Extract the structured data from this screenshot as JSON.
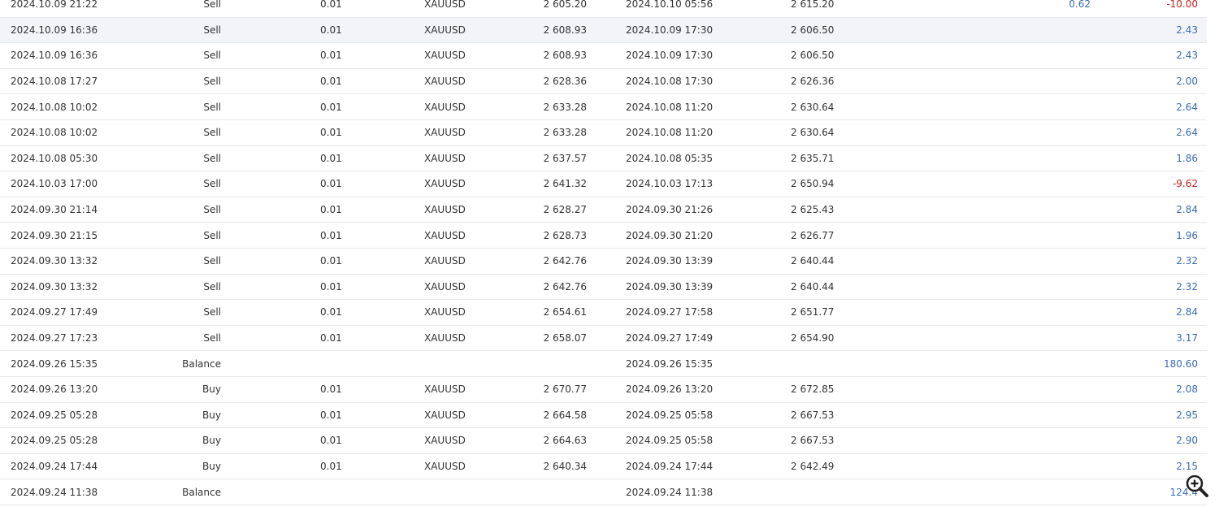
{
  "colors": {
    "positive": "#3b6cb4",
    "negative": "#cc1f1f",
    "row_highlight": "#f3f4f7",
    "row_border": "#e4e7ec"
  },
  "zoom_button": {
    "icon": "zoom-in-icon"
  },
  "rows": [
    {
      "open_time": "2024.10.09 21:22",
      "type": "Sell",
      "volume": "0.01",
      "symbol": "XAUUSD",
      "open_price": "2 605.20",
      "close_time": "2024.10.10 05:56",
      "close_price": "2 615.20",
      "extra": "0.62",
      "profit": "-10.00",
      "sign": "neg"
    },
    {
      "open_time": "2024.10.09 16:36",
      "type": "Sell",
      "volume": "0.01",
      "symbol": "XAUUSD",
      "open_price": "2 608.93",
      "close_time": "2024.10.09 17:30",
      "close_price": "2 606.50",
      "extra": "",
      "profit": "2.43",
      "sign": "pos"
    },
    {
      "open_time": "2024.10.09 16:36",
      "type": "Sell",
      "volume": "0.01",
      "symbol": "XAUUSD",
      "open_price": "2 608.93",
      "close_time": "2024.10.09 17:30",
      "close_price": "2 606.50",
      "extra": "",
      "profit": "2.43",
      "sign": "pos"
    },
    {
      "open_time": "2024.10.08 17:27",
      "type": "Sell",
      "volume": "0.01",
      "symbol": "XAUUSD",
      "open_price": "2 628.36",
      "close_time": "2024.10.08 17:30",
      "close_price": "2 626.36",
      "extra": "",
      "profit": "2.00",
      "sign": "pos"
    },
    {
      "open_time": "2024.10.08 10:02",
      "type": "Sell",
      "volume": "0.01",
      "symbol": "XAUUSD",
      "open_price": "2 633.28",
      "close_time": "2024.10.08 11:20",
      "close_price": "2 630.64",
      "extra": "",
      "profit": "2.64",
      "sign": "pos"
    },
    {
      "open_time": "2024.10.08 10:02",
      "type": "Sell",
      "volume": "0.01",
      "symbol": "XAUUSD",
      "open_price": "2 633.28",
      "close_time": "2024.10.08 11:20",
      "close_price": "2 630.64",
      "extra": "",
      "profit": "2.64",
      "sign": "pos"
    },
    {
      "open_time": "2024.10.08 05:30",
      "type": "Sell",
      "volume": "0.01",
      "symbol": "XAUUSD",
      "open_price": "2 637.57",
      "close_time": "2024.10.08 05:35",
      "close_price": "2 635.71",
      "extra": "",
      "profit": "1.86",
      "sign": "pos"
    },
    {
      "open_time": "2024.10.03 17:00",
      "type": "Sell",
      "volume": "0.01",
      "symbol": "XAUUSD",
      "open_price": "2 641.32",
      "close_time": "2024.10.03 17:13",
      "close_price": "2 650.94",
      "extra": "",
      "profit": "-9.62",
      "sign": "neg"
    },
    {
      "open_time": "2024.09.30 21:14",
      "type": "Sell",
      "volume": "0.01",
      "symbol": "XAUUSD",
      "open_price": "2 628.27",
      "close_time": "2024.09.30 21:26",
      "close_price": "2 625.43",
      "extra": "",
      "profit": "2.84",
      "sign": "pos"
    },
    {
      "open_time": "2024.09.30 21:15",
      "type": "Sell",
      "volume": "0.01",
      "symbol": "XAUUSD",
      "open_price": "2 628.73",
      "close_time": "2024.09.30 21:20",
      "close_price": "2 626.77",
      "extra": "",
      "profit": "1.96",
      "sign": "pos"
    },
    {
      "open_time": "2024.09.30 13:32",
      "type": "Sell",
      "volume": "0.01",
      "symbol": "XAUUSD",
      "open_price": "2 642.76",
      "close_time": "2024.09.30 13:39",
      "close_price": "2 640.44",
      "extra": "",
      "profit": "2.32",
      "sign": "pos"
    },
    {
      "open_time": "2024.09.30 13:32",
      "type": "Sell",
      "volume": "0.01",
      "symbol": "XAUUSD",
      "open_price": "2 642.76",
      "close_time": "2024.09.30 13:39",
      "close_price": "2 640.44",
      "extra": "",
      "profit": "2.32",
      "sign": "pos"
    },
    {
      "open_time": "2024.09.27 17:49",
      "type": "Sell",
      "volume": "0.01",
      "symbol": "XAUUSD",
      "open_price": "2 654.61",
      "close_time": "2024.09.27 17:58",
      "close_price": "2 651.77",
      "extra": "",
      "profit": "2.84",
      "sign": "pos"
    },
    {
      "open_time": "2024.09.27 17:23",
      "type": "Sell",
      "volume": "0.01",
      "symbol": "XAUUSD",
      "open_price": "2 658.07",
      "close_time": "2024.09.27 17:49",
      "close_price": "2 654.90",
      "extra": "",
      "profit": "3.17",
      "sign": "pos"
    },
    {
      "open_time": "2024.09.26 15:35",
      "type": "Balance",
      "volume": "",
      "symbol": "",
      "open_price": "",
      "close_time": "2024.09.26 15:35",
      "close_price": "",
      "extra": "",
      "profit": "180.60",
      "sign": "pos"
    },
    {
      "open_time": "2024.09.26 13:20",
      "type": "Buy",
      "volume": "0.01",
      "symbol": "XAUUSD",
      "open_price": "2 670.77",
      "close_time": "2024.09.26 13:20",
      "close_price": "2 672.85",
      "extra": "",
      "profit": "2.08",
      "sign": "pos"
    },
    {
      "open_time": "2024.09.25 05:28",
      "type": "Buy",
      "volume": "0.01",
      "symbol": "XAUUSD",
      "open_price": "2 664.58",
      "close_time": "2024.09.25 05:58",
      "close_price": "2 667.53",
      "extra": "",
      "profit": "2.95",
      "sign": "pos"
    },
    {
      "open_time": "2024.09.25 05:28",
      "type": "Buy",
      "volume": "0.01",
      "symbol": "XAUUSD",
      "open_price": "2 664.63",
      "close_time": "2024.09.25 05:58",
      "close_price": "2 667.53",
      "extra": "",
      "profit": "2.90",
      "sign": "pos"
    },
    {
      "open_time": "2024.09.24 17:44",
      "type": "Buy",
      "volume": "0.01",
      "symbol": "XAUUSD",
      "open_price": "2 640.34",
      "close_time": "2024.09.24 17:44",
      "close_price": "2 642.49",
      "extra": "",
      "profit": "2.15",
      "sign": "pos"
    },
    {
      "open_time": "2024.09.24 11:38",
      "type": "Balance",
      "volume": "",
      "symbol": "",
      "open_price": "",
      "close_time": "2024.09.24 11:38",
      "close_price": "",
      "extra": "",
      "profit": "124.4",
      "sign": "pos"
    }
  ]
}
